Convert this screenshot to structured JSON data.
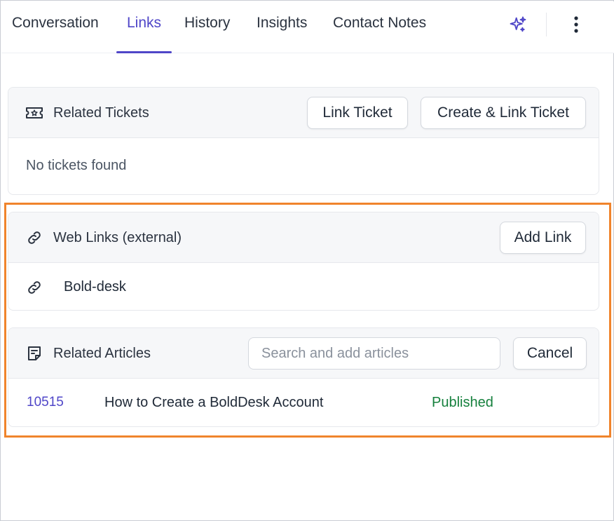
{
  "tabs": [
    {
      "label": "Conversation"
    },
    {
      "label": "Links"
    },
    {
      "label": "History"
    },
    {
      "label": "Insights"
    },
    {
      "label": "Contact Notes"
    }
  ],
  "active_tab": "Links",
  "toolbar": {
    "ai_icon": "sparkle-icon",
    "more_icon": "more-vertical-icon"
  },
  "related_tickets": {
    "title": "Related Tickets",
    "icon": "ticket-icon",
    "link_button": "Link Ticket",
    "create_button": "Create & Link Ticket",
    "empty_text": "No tickets found"
  },
  "web_links": {
    "title": "Web Links (external)",
    "icon": "link-icon",
    "add_button": "Add Link",
    "items": [
      {
        "label": "Bold-desk",
        "icon": "link-icon"
      }
    ]
  },
  "related_articles": {
    "title": "Related Articles",
    "icon": "article-icon",
    "search_placeholder": "Search and add articles",
    "search_value": "",
    "cancel_button": "Cancel",
    "items": [
      {
        "id": "10515",
        "title": "How to Create a BoldDesk Account",
        "status": "Published"
      }
    ]
  },
  "colors": {
    "accent": "#4f46c8",
    "highlight": "#f0842c",
    "published": "#15803d",
    "article_id": "#4f46c8"
  }
}
